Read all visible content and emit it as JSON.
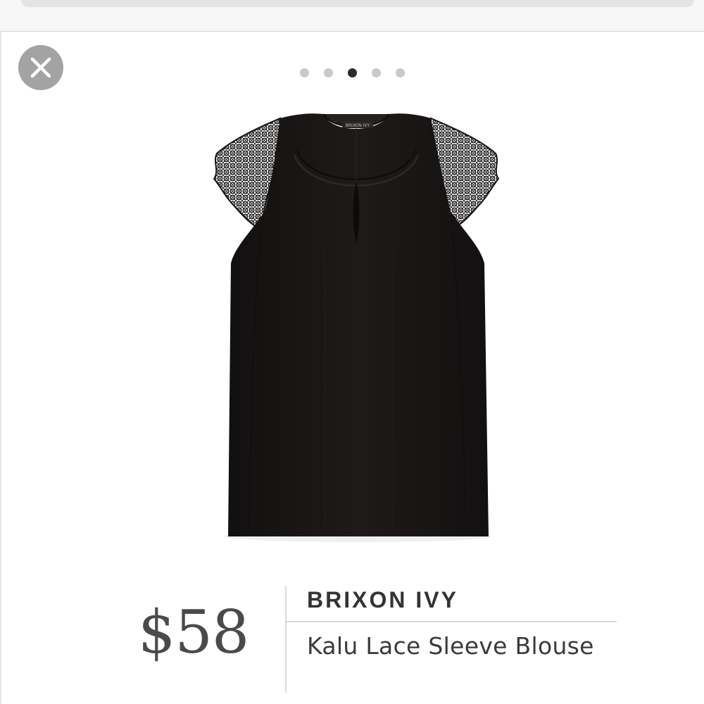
{
  "close": {
    "icon": "close-icon"
  },
  "carousel": {
    "total": 5,
    "active_index": 2
  },
  "product": {
    "image_icon": "lace-sleeve-blouse-image",
    "tag_text": "BRIXON IVY",
    "price": "$58",
    "brand": "BRIXON IVY",
    "name": "Kalu Lace Sleeve Blouse"
  },
  "colors": {
    "garment": "#1a1716",
    "close_bg": "#a3a3a3",
    "dot_inactive": "#c9c9c9",
    "dot_active": "#2b2b2b"
  }
}
